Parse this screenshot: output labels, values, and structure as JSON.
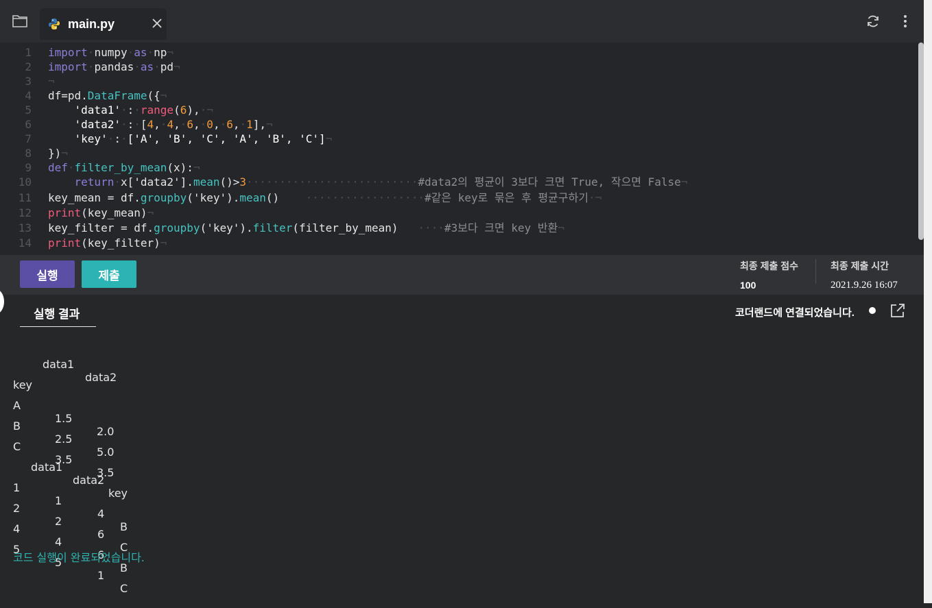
{
  "tab": {
    "filename": "main.py"
  },
  "code": {
    "lines": [
      {
        "n": "1"
      },
      {
        "n": "2"
      },
      {
        "n": "3"
      },
      {
        "n": "4"
      },
      {
        "n": "5"
      },
      {
        "n": "6"
      },
      {
        "n": "7"
      },
      {
        "n": "8"
      },
      {
        "n": "9"
      },
      {
        "n": "10"
      },
      {
        "n": "11"
      },
      {
        "n": "12"
      },
      {
        "n": "13"
      },
      {
        "n": "14"
      }
    ],
    "l1": [
      "import",
      "numpy",
      "as",
      "np"
    ],
    "l2": [
      "import",
      "pandas",
      "as",
      "pd"
    ],
    "l4": [
      "df=pd.",
      "DataFrame",
      "({"
    ],
    "l5": [
      "'data1'",
      ":",
      "range",
      "(",
      "6",
      "),"
    ],
    "l6": [
      "'data2'",
      ":",
      "[",
      "4",
      ",",
      "4",
      ",",
      "6",
      ",",
      "0",
      ",",
      "6",
      ",",
      "1",
      "],"
    ],
    "l7": [
      "'key'",
      ":",
      "['A', 'B', 'C', 'A', 'B', 'C']"
    ],
    "l8": [
      "})"
    ],
    "l9": [
      "def",
      "filter_by_mean",
      "(x):"
    ],
    "l10": [
      "return",
      "x['data2'].",
      "mean",
      "()>",
      "3",
      "#data2의 평균이 3보다 크면 True, 작으면 False"
    ],
    "l11": [
      "key_mean = df.",
      "groupby",
      "('key').",
      "mean",
      "()",
      "#같은 key로 묶은 후 평균구하기"
    ],
    "l12": [
      "print",
      "(key_mean)"
    ],
    "l13": [
      "key_filter = df.",
      "groupby",
      "('key').",
      "filter",
      "(filter_by_mean)",
      "#3보다 크면 key 반환"
    ],
    "l14": [
      "print",
      "(key_filter)"
    ]
  },
  "actions": {
    "run_label": "실행",
    "submit_label": "제출"
  },
  "submission": {
    "score_label": "최종 제출 점수",
    "score_value": "100",
    "time_label": "최종 제출 시간",
    "time_value": "2021.9.26 16:07"
  },
  "result": {
    "tab_label": "실행 결과",
    "connection_status": "코더랜드에 연결되었습니다.",
    "output": {
      "mean_header": [
        "data1",
        "data2"
      ],
      "mean_index_name": "key",
      "mean_rows": [
        [
          "A",
          "1.5",
          "2.0"
        ],
        [
          "B",
          "2.5",
          "5.0"
        ],
        [
          "C",
          "3.5",
          "3.5"
        ]
      ],
      "filter_header": [
        "data1",
        "data2",
        "key"
      ],
      "filter_rows": [
        [
          "1",
          "1",
          "4",
          "B"
        ],
        [
          "2",
          "2",
          "6",
          "C"
        ],
        [
          "4",
          "4",
          "6",
          "B"
        ],
        [
          "5",
          "5",
          "1",
          "C"
        ]
      ],
      "done_message": "코드 실행이 완료되었습니다."
    }
  },
  "colors": {
    "keyword": "#8b7fd8",
    "function": "#46c3c0",
    "builtin": "#f25b7c",
    "number": "#f29b3b",
    "run_button": "#5a4fa4",
    "submit_button": "#2cb3b4"
  },
  "icons": [
    "folder-icon",
    "python-icon",
    "close-icon",
    "refresh-icon",
    "more-vertical-icon",
    "external-link-icon"
  ]
}
